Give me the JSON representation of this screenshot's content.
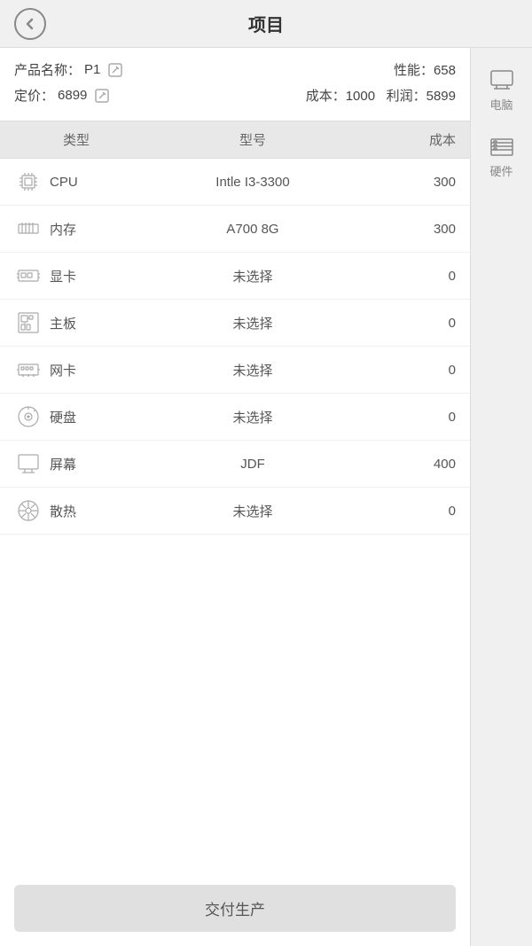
{
  "header": {
    "title": "项目",
    "back_label": "返回"
  },
  "info": {
    "product_label": "产品名称：",
    "product_value": "P1",
    "performance_label": "性能：",
    "performance_value": "658",
    "price_label": "定价：",
    "price_value": "6899",
    "cost_label": "成本：",
    "cost_value": "1000",
    "profit_label": "利润：",
    "profit_value": "5899"
  },
  "table": {
    "col_type": "类型",
    "col_model": "型号",
    "col_cost": "成本",
    "rows": [
      {
        "icon": "cpu",
        "type": "CPU",
        "model": "Intle I3-3300",
        "cost": "300"
      },
      {
        "icon": "memory",
        "type": "内存",
        "model": "A700 8G",
        "cost": "300"
      },
      {
        "icon": "gpu",
        "type": "显卡",
        "model": "未选择",
        "cost": "0"
      },
      {
        "icon": "motherboard",
        "type": "主板",
        "model": "未选择",
        "cost": "0"
      },
      {
        "icon": "network",
        "type": "网卡",
        "model": "未选择",
        "cost": "0"
      },
      {
        "icon": "hdd",
        "type": "硬盘",
        "model": "未选择",
        "cost": "0"
      },
      {
        "icon": "monitor",
        "type": "屏幕",
        "model": "JDF",
        "cost": "400"
      },
      {
        "icon": "cooling",
        "type": "散热",
        "model": "未选择",
        "cost": "0"
      }
    ]
  },
  "sidebar": {
    "items": [
      {
        "label": "电脑",
        "icon": "computer"
      },
      {
        "label": "硬件",
        "icon": "hardware"
      }
    ]
  },
  "footer": {
    "submit_label": "交付生产"
  }
}
